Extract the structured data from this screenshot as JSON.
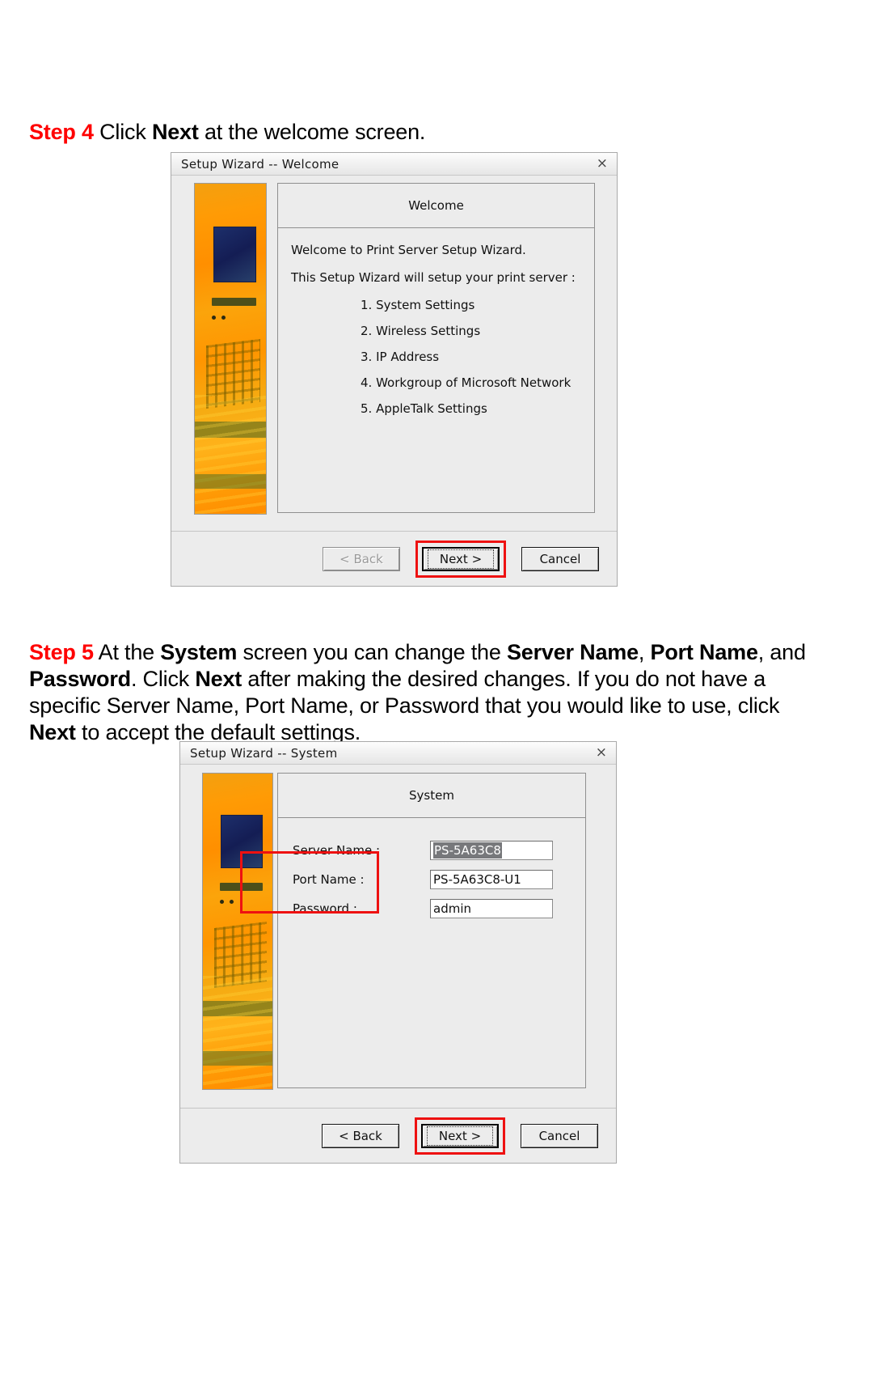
{
  "step4": {
    "label": "Step 4",
    "text_before": " Click ",
    "bold_1": "Next",
    "text_after": " at the welcome screen."
  },
  "step5": {
    "label": "Step 5",
    "seg_1": " At the ",
    "bold_1": "System",
    "seg_2": " screen you can change the ",
    "bold_2": "Server Name",
    "seg_3": ", ",
    "bold_3": "Port Name",
    "seg_4": ", and ",
    "bold_4": "Password",
    "seg_5": ".  Click ",
    "bold_5": "Next",
    "seg_6": " after making the desired changes.  If you do not have a specific Server Name, Port Name, or Password that you would like to use, click ",
    "bold_6": "Next",
    "seg_7": " to accept the default settings."
  },
  "welcome_dialog": {
    "title": "Setup Wizard -- Welcome",
    "close_icon": "×",
    "panel_title": "Welcome",
    "intro_line_1": "Welcome to Print Server Setup Wizard.",
    "intro_line_2": "This Setup Wizard will setup your print server :",
    "steps": [
      "1. System Settings",
      "2. Wireless Settings",
      "3. IP Address",
      "4. Workgroup of Microsoft Network",
      "5. AppleTalk Settings"
    ],
    "buttons": {
      "back": "< Back",
      "back_mnemonic": "B",
      "next": "Next >",
      "next_mnemonic": "N",
      "cancel": "Cancel"
    },
    "back_enabled": false,
    "next_highlighted": true
  },
  "system_dialog": {
    "title": "Setup Wizard -- System",
    "close_icon": "×",
    "panel_title": "System",
    "fields": [
      {
        "label": "Server Name :",
        "value": "PS-5A63C8",
        "selected": true
      },
      {
        "label": "Port Name :",
        "value": "PS-5A63C8-U1",
        "selected": false
      },
      {
        "label": "Password :",
        "value": "admin",
        "selected": false
      }
    ],
    "buttons": {
      "back": "< Back",
      "back_mnemonic": "B",
      "next": "Next >",
      "next_mnemonic": "N",
      "cancel": "Cancel"
    },
    "back_enabled": true,
    "next_highlighted": true
  },
  "colors": {
    "step_label": "#ff0000",
    "highlight_box": "#ee1111",
    "dialog_face": "#ececec",
    "selection": "#77787b"
  }
}
